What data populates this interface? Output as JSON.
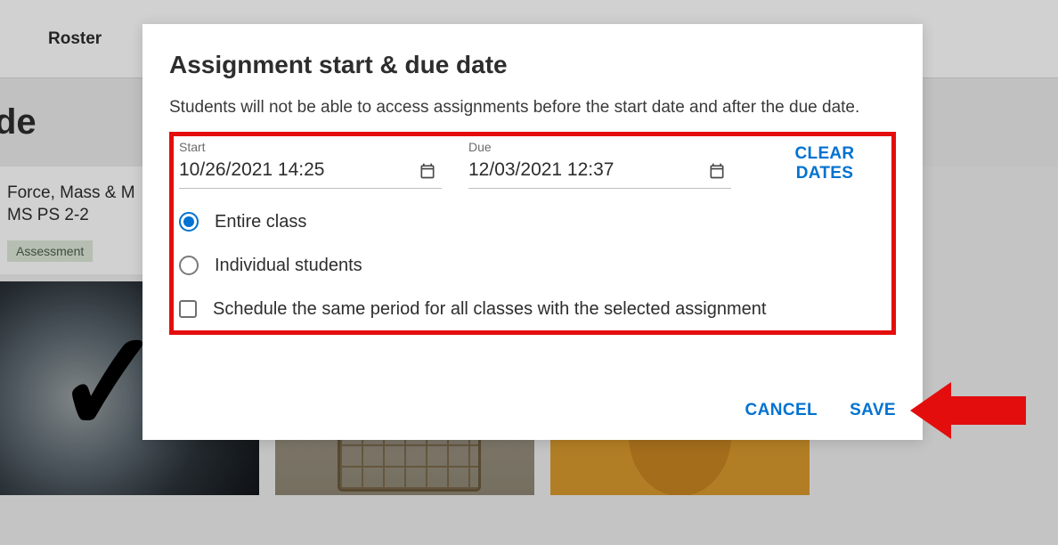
{
  "background": {
    "tabs": {
      "roster": "Roster"
    },
    "title_fragment": "de",
    "card": {
      "lesson_title": "Force, Mass & M",
      "lesson_subtitle": "MS PS 2-2",
      "badge": "Assessment"
    }
  },
  "modal": {
    "title": "Assignment start & due date",
    "description": "Students will not be able to access assignments before the start date and after the due date.",
    "start_label": "Start",
    "start_value": "10/26/2021 14:25",
    "due_label": "Due",
    "due_value": "12/03/2021 12:37",
    "clear_dates": "CLEAR DATES",
    "radio_entire_class": "Entire class",
    "radio_individual": "Individual students",
    "checkbox_all_classes": "Schedule the same period for all classes with the selected assignment",
    "cancel": "CANCEL",
    "save": "SAVE"
  },
  "icons": {
    "calendar": "calendar-icon"
  },
  "colors": {
    "accent": "#0072d1",
    "highlight": "#e40d0d"
  }
}
